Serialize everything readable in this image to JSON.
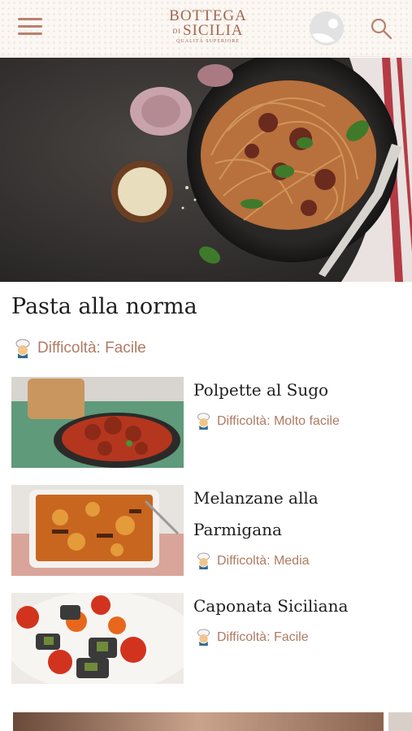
{
  "header": {
    "logo_line1": "BOTTEGA",
    "logo_di": "DI",
    "logo_line2": "SICILIA",
    "logo_tagline": "QUALITÀ SUPERIORE",
    "icons": [
      "menu-icon",
      "user-icon",
      "search-icon"
    ]
  },
  "hero": {
    "title": "Pasta alla norma",
    "difficulty": "Difficoltà: Facile"
  },
  "recipes": [
    {
      "title_lines": [
        "Polpette al Sugo"
      ],
      "difficulty": "Difficoltà: Molto facile"
    },
    {
      "title_lines": [
        "Melanzane alla",
        "Parmigana"
      ],
      "difficulty": "Difficoltà: Media"
    },
    {
      "title_lines": [
        "Caponata Siciliana"
      ],
      "difficulty": "Difficoltà: Facile"
    }
  ],
  "colors": {
    "accent": "#b07a63",
    "header_bg": "#fbf7f3",
    "title_text": "#1e1e1e"
  }
}
